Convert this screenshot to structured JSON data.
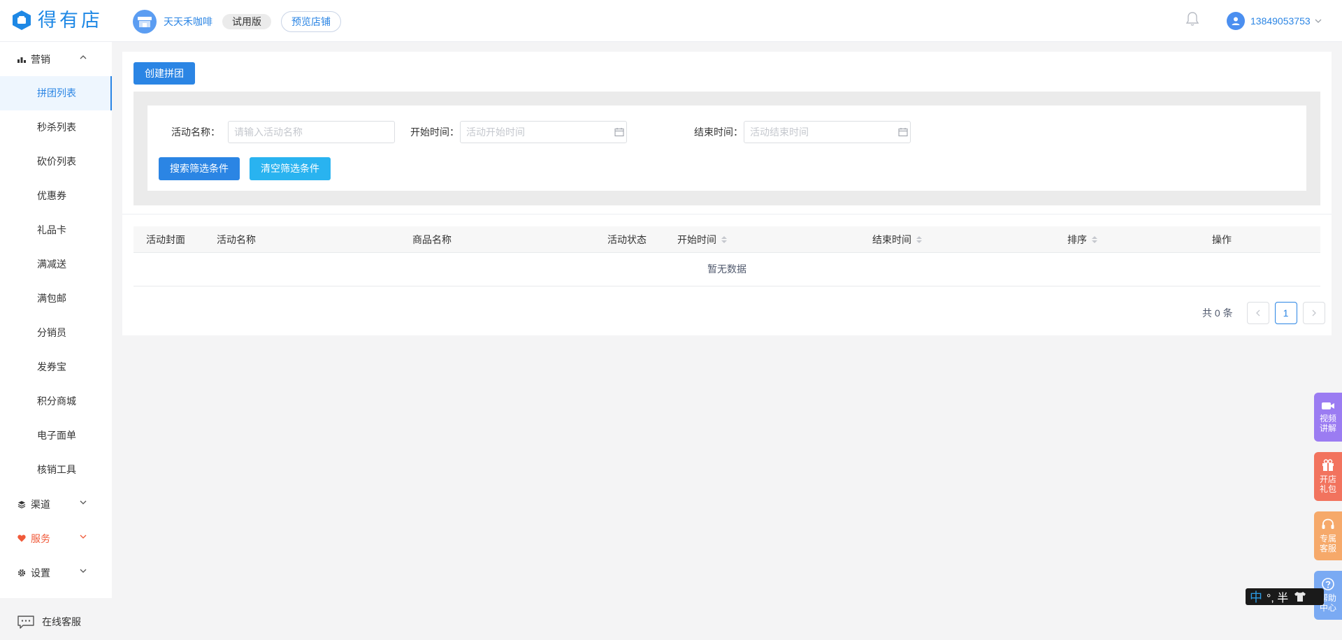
{
  "header": {
    "logo_text": "得有店",
    "shop_name": "天天禾咖啡",
    "version_badge": "试用版",
    "preview_label": "预览店铺",
    "user_phone": "13849053753"
  },
  "sidebar": {
    "groups": [
      {
        "label": "营销",
        "icon": "bar-chart-icon"
      },
      {
        "label": "渠道",
        "icon": "layers-icon"
      },
      {
        "label": "服务",
        "icon": "heart-icon"
      },
      {
        "label": "设置",
        "icon": "gear-icon"
      }
    ],
    "items": [
      "拼团列表",
      "秒杀列表",
      "砍价列表",
      "优惠券",
      "礼品卡",
      "满减送",
      "满包邮",
      "分销员",
      "发券宝",
      "积分商城",
      "电子面单",
      "核销工具"
    ],
    "active_item": "拼团列表",
    "online_service": "在线客服"
  },
  "main": {
    "create_button": "创建拼团",
    "filters": {
      "name_label": "活动名称：",
      "name_placeholder": "请输入活动名称",
      "start_label": "开始时间：",
      "start_placeholder": "活动开始时间",
      "end_label": "结束时间：",
      "end_placeholder": "活动结束时间",
      "search_button": "搜索筛选条件",
      "clear_button": "清空筛选条件"
    },
    "table": {
      "columns": [
        "活动封面",
        "活动名称",
        "商品名称",
        "活动状态",
        "开始时间",
        "结束时间",
        "排序",
        "操作"
      ],
      "empty_text": "暂无数据"
    },
    "pagination": {
      "total_text": "共 0 条",
      "current_page": "1"
    }
  },
  "floating": {
    "video": "视频讲解",
    "gift": "开店礼包",
    "service": "专属客服",
    "help": "帮助中心"
  },
  "ime": {
    "mode": "中",
    "punct": "°, 半"
  },
  "colors": {
    "primary": "#2b85e4",
    "clear_button": "#29b3f0",
    "service": "#f05a3a",
    "float_video": "#9b7cf2",
    "float_gift": "#f2735e",
    "float_service": "#f6a96a",
    "float_help": "#7aaaf3"
  }
}
